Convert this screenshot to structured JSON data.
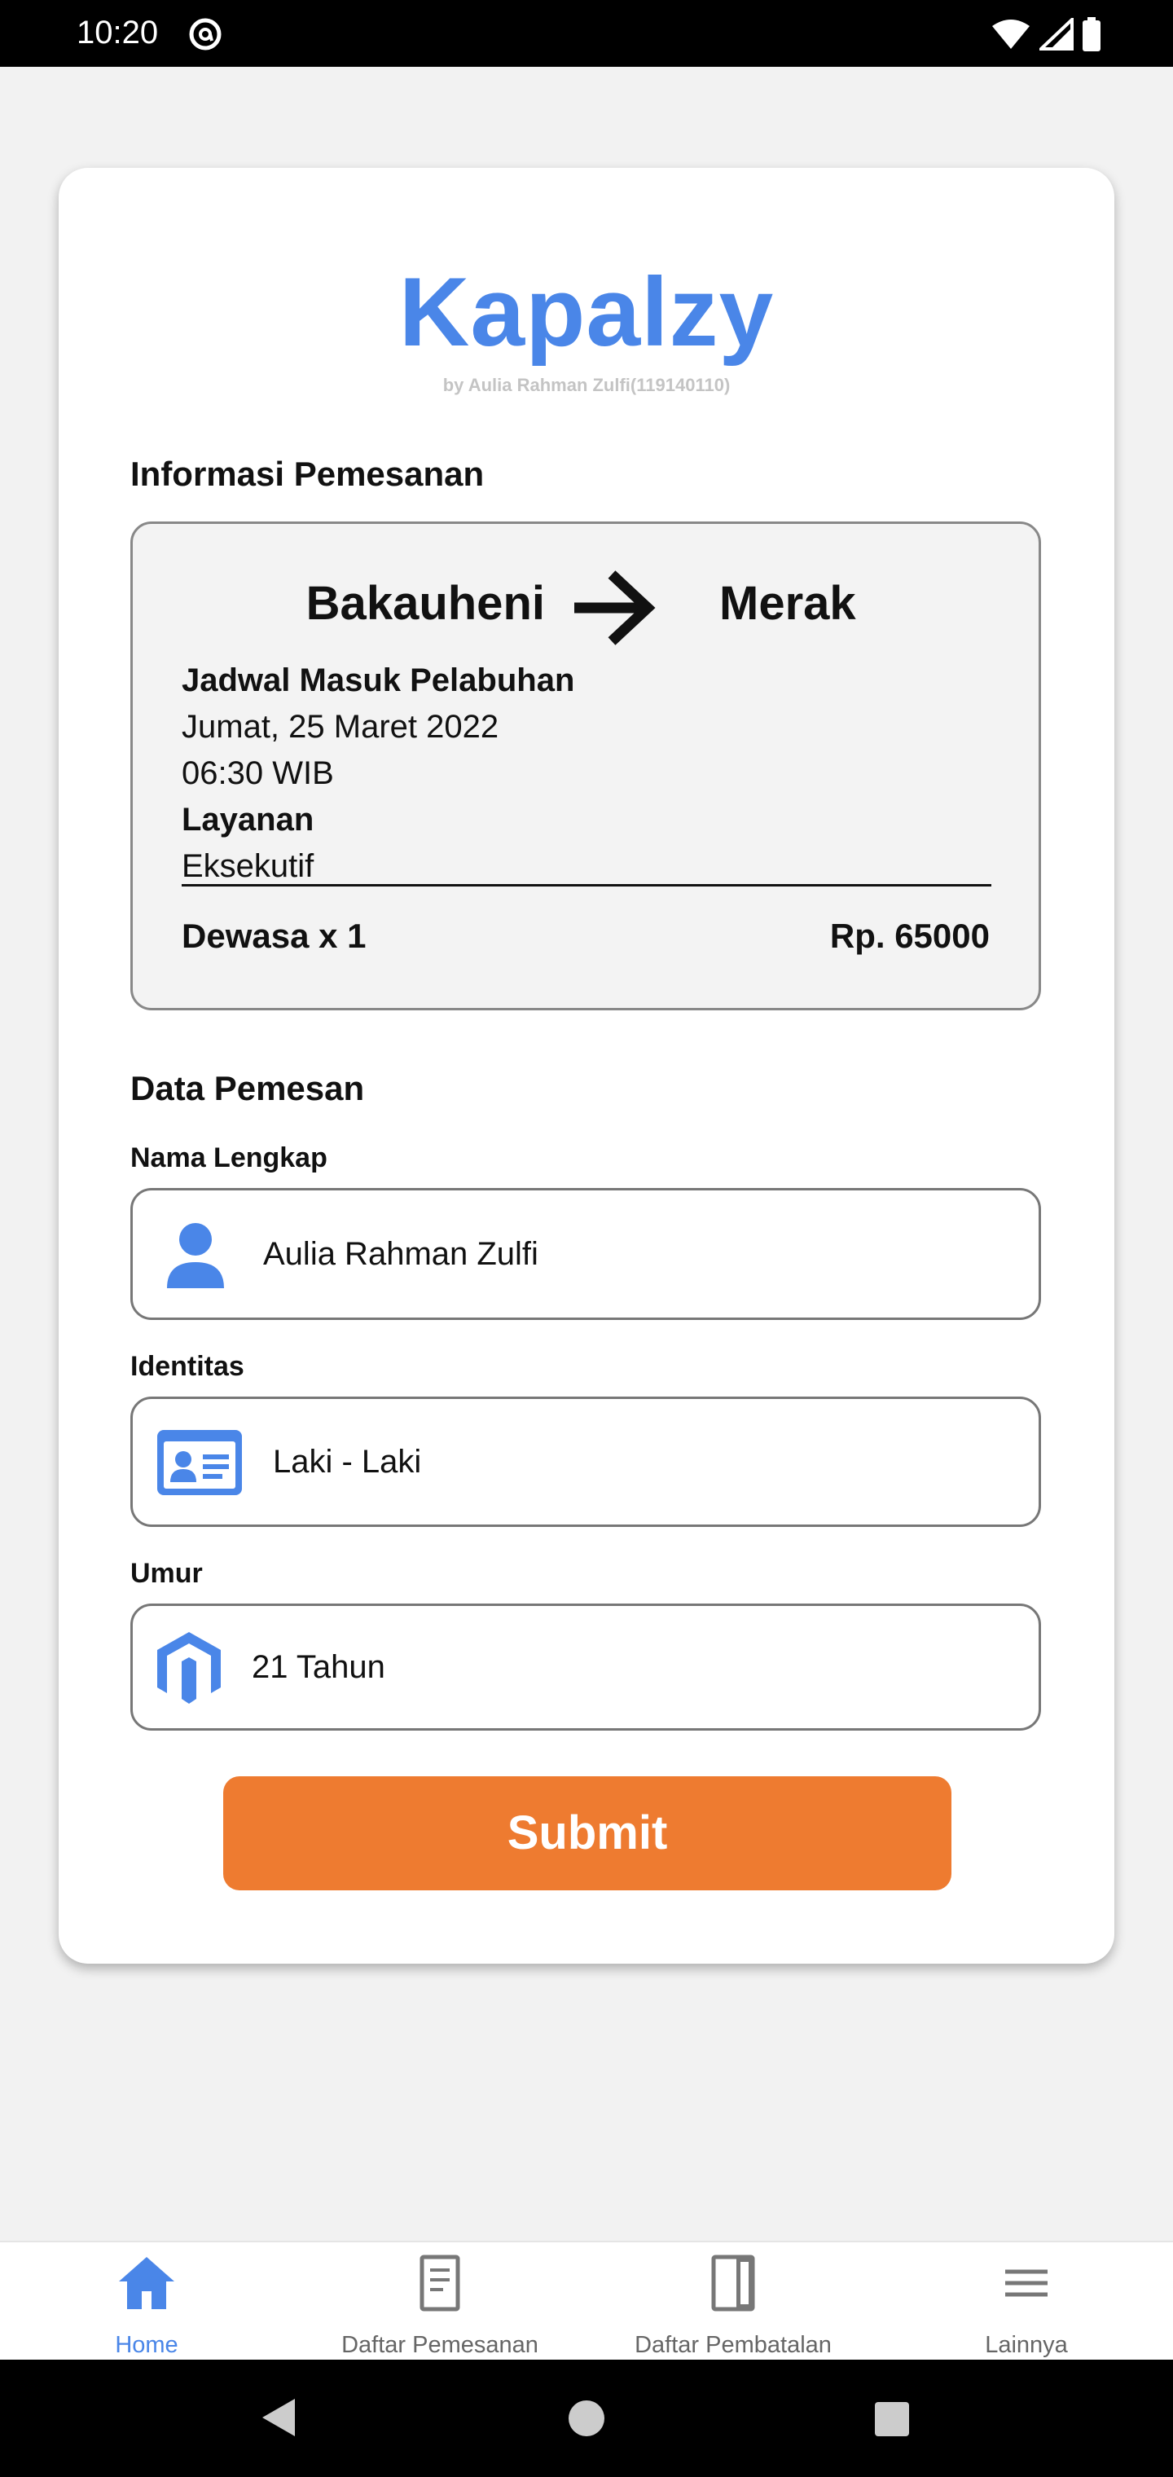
{
  "status_bar": {
    "time": "10:20"
  },
  "app": {
    "logo": "Kapalzy",
    "byline": "by Aulia Rahman Zulfi(119140110)"
  },
  "booking_info": {
    "section_title": "Informasi Pemesanan",
    "from": "Bakauheni",
    "to": "Merak",
    "schedule_label": "Jadwal Masuk Pelabuhan",
    "date": "Jumat, 25 Maret 2022",
    "time": "06:30 WIB",
    "service_label": "Layanan",
    "service": "Eksekutif",
    "passenger": "Dewasa x 1",
    "price": "Rp. 65000"
  },
  "orderer": {
    "section_title": "Data Pemesan",
    "name_label": "Nama Lengkap",
    "name_value": "Aulia Rahman Zulfi",
    "identity_label": "Identitas",
    "identity_value": "Laki - Laki",
    "age_label": "Umur",
    "age_value": "21 Tahun"
  },
  "submit_label": "Submit",
  "bottom_nav": {
    "items": [
      {
        "label": "Home",
        "icon": "home-icon",
        "active": true
      },
      {
        "label": "Daftar Pemesanan",
        "icon": "document-icon",
        "active": false
      },
      {
        "label": "Daftar Pembatalan",
        "icon": "book-icon",
        "active": false
      },
      {
        "label": "Lainnya",
        "icon": "menu-icon",
        "active": false
      }
    ]
  },
  "colors": {
    "accent": "#4a86e8",
    "submit": "#ee7b30"
  }
}
